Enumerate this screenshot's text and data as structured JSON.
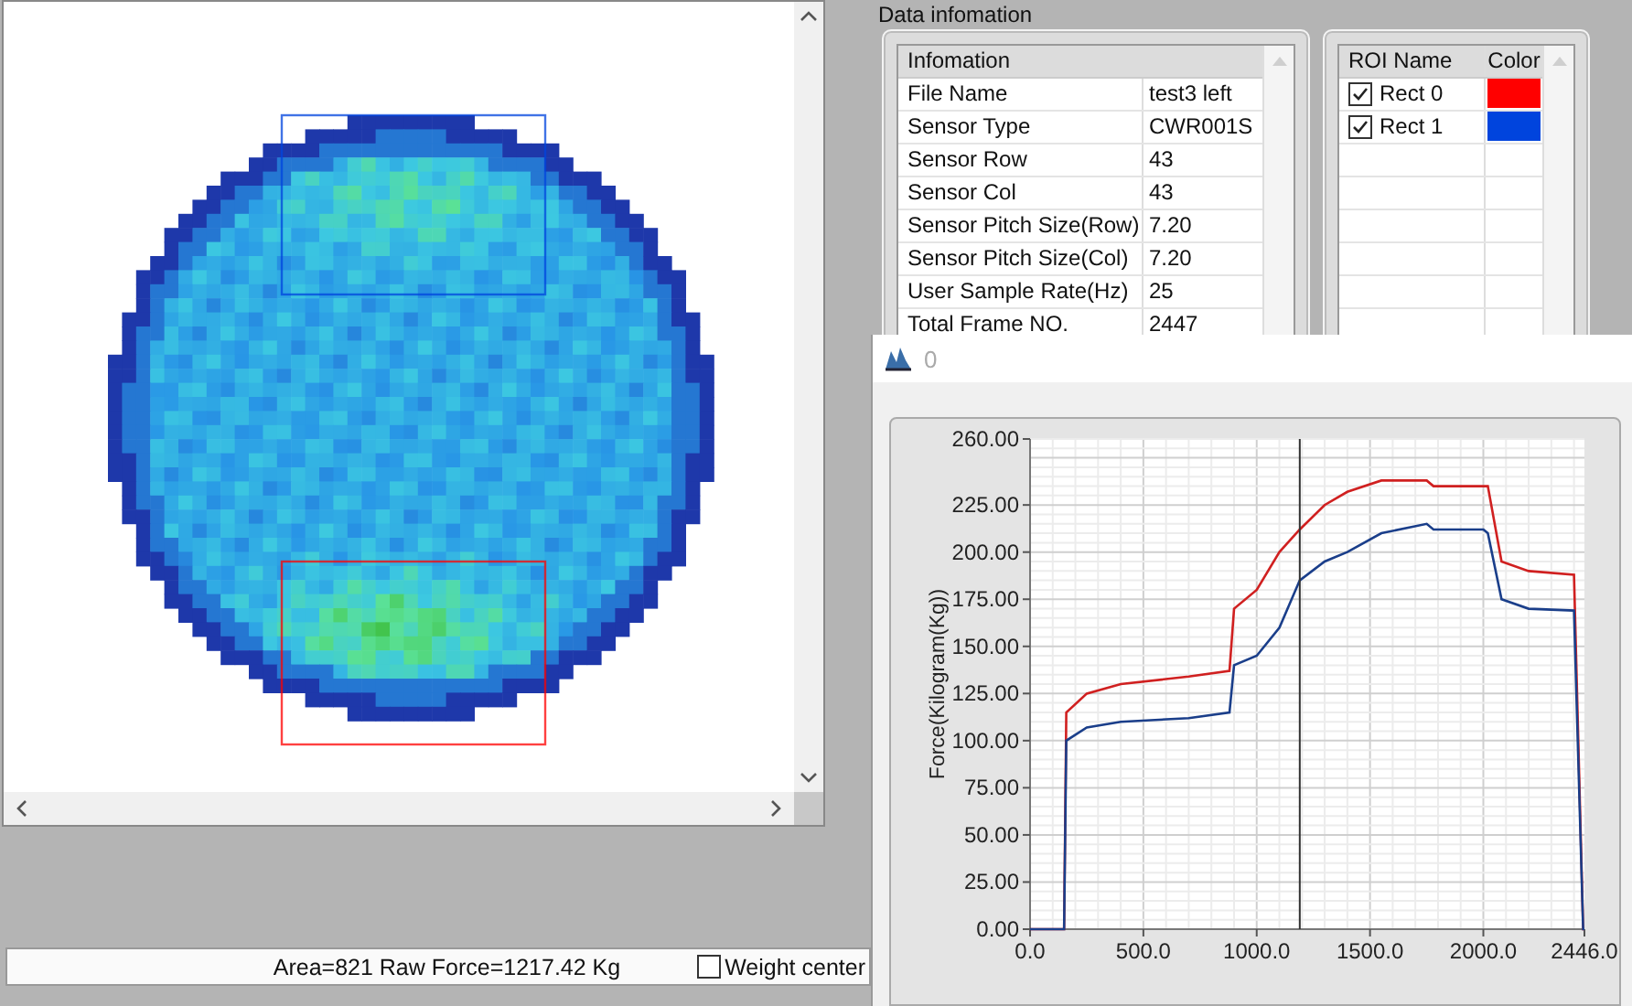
{
  "section_title": "Data infomation",
  "info_table": {
    "header": "Infomation",
    "rows": [
      {
        "name": "File Name",
        "value": "test3 left"
      },
      {
        "name": "Sensor Type",
        "value": "CWR001S"
      },
      {
        "name": "Sensor Row",
        "value": "43"
      },
      {
        "name": "Sensor Col",
        "value": "43"
      },
      {
        "name": "Sensor Pitch Size(Row)",
        "value": "7.20"
      },
      {
        "name": "Sensor Pitch Size(Col)",
        "value": "7.20"
      },
      {
        "name": "User Sample Rate(Hz)",
        "value": "25"
      },
      {
        "name": "Total Frame NO.",
        "value": "2447"
      }
    ]
  },
  "roi_table": {
    "columns": [
      "ROI Name",
      "Color"
    ],
    "rows": [
      {
        "name": "Rect 0",
        "checked": true,
        "color": "#ff0000"
      },
      {
        "name": "Rect 1",
        "checked": true,
        "color": "#0044dd"
      }
    ]
  },
  "status_bar": {
    "text": "Area=821 Raw  Force=1217.42 Kg",
    "weight_center": {
      "label": "Weight center",
      "checked": false
    }
  },
  "graph_window": {
    "title": "0",
    "chart_data": {
      "type": "line",
      "ylabel": "Force(Kilogram(Kg))",
      "x": [
        0,
        150,
        160,
        250,
        400,
        700,
        880,
        900,
        1000,
        1100,
        1190,
        1300,
        1400,
        1550,
        1750,
        1780,
        2000,
        2020,
        2080,
        2200,
        2400,
        2440,
        2446
      ],
      "series": [
        {
          "color": "#d02020",
          "values": [
            0,
            0,
            115,
            125,
            130,
            134,
            137,
            170,
            180,
            200,
            212,
            225,
            232,
            238,
            238,
            235,
            235,
            235,
            195,
            190,
            188,
            0,
            0
          ]
        },
        {
          "color": "#1a3e8a",
          "values": [
            0,
            0,
            100,
            107,
            110,
            112,
            115,
            140,
            145,
            160,
            185,
            195,
            200,
            210,
            215,
            212,
            212,
            210,
            175,
            170,
            169,
            0,
            0
          ]
        }
      ],
      "xlim": [
        0,
        2446
      ],
      "ylim": [
        0,
        260
      ],
      "grid": true,
      "xticks": [
        {
          "value": 0,
          "label": "0.0"
        },
        {
          "value": 500,
          "label": "500.0"
        },
        {
          "value": 1000,
          "label": "1000.0"
        },
        {
          "value": 1500,
          "label": "1500.0"
        },
        {
          "value": 2000,
          "label": "2000.0"
        },
        {
          "value": 2446,
          "label": "2446.0"
        }
      ],
      "yticks": [
        {
          "value": 0,
          "label": "0.00"
        },
        {
          "value": 25,
          "label": "25.00"
        },
        {
          "value": 50,
          "label": "50.00"
        },
        {
          "value": 75,
          "label": "75.00"
        },
        {
          "value": 100,
          "label": "100.00"
        },
        {
          "value": 125,
          "label": "125.00"
        },
        {
          "value": 150,
          "label": "150.00"
        },
        {
          "value": 175,
          "label": "175.00"
        },
        {
          "value": 200,
          "label": "200.00"
        },
        {
          "value": 225,
          "label": "225.00"
        },
        {
          "value": 260,
          "label": "260.00"
        }
      ],
      "ref_lines": [
        {
          "axis": "x",
          "value": 1190
        }
      ]
    }
  }
}
